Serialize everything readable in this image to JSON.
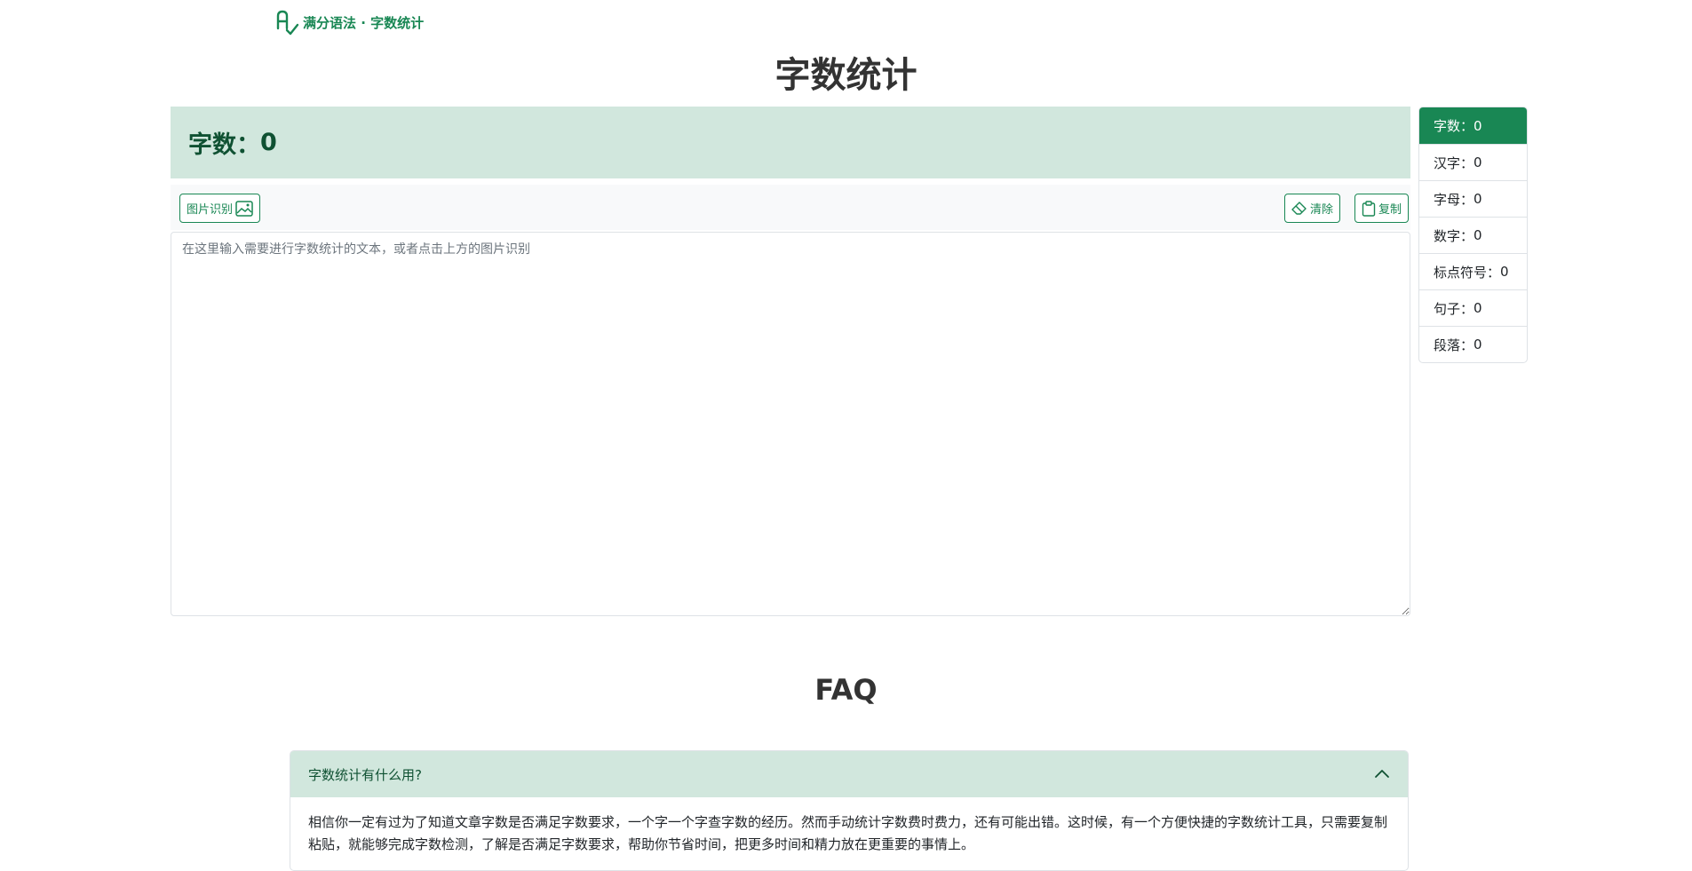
{
  "brand": {
    "name": "满分语法 · 字数统计",
    "logo": "grammar-check-logo"
  },
  "page_title": "字数统计",
  "banner": {
    "label": "字数：",
    "value": "0"
  },
  "toolbar": {
    "image_ocr_label": "图片识别",
    "clear_label": "清除",
    "copy_label": "复制"
  },
  "editor": {
    "placeholder": "在这里输入需要进行字数统计的文本，或者点击上方的图片识别",
    "value": ""
  },
  "stats": [
    {
      "label": "字数：",
      "value": "0"
    },
    {
      "label": "汉字：",
      "value": "0"
    },
    {
      "label": "字母：",
      "value": "0"
    },
    {
      "label": "数字：",
      "value": "0"
    },
    {
      "label": "标点符号：",
      "value": "0"
    },
    {
      "label": "句子：",
      "value": "0"
    },
    {
      "label": "段落：",
      "value": "0"
    }
  ],
  "faq": {
    "title": "FAQ",
    "items": [
      {
        "question": "字数统计有什么用?",
        "answer": "相信你一定有过为了知道文章字数是否满足字数要求，一个字一个字查字数的经历。然而手动统计字数费时费力，还有可能出错。这时候，有一个方便快捷的字数统计工具，只需要复制粘贴，就能够完成字数检测，了解是否满足字数要求，帮助你节省时间，把更多时间和精力放在更重要的事情上。",
        "expanded": true
      }
    ]
  },
  "colors": {
    "accent": "#198754",
    "banner_bg": "#d1e7dd",
    "banner_text": "#0f5132"
  }
}
